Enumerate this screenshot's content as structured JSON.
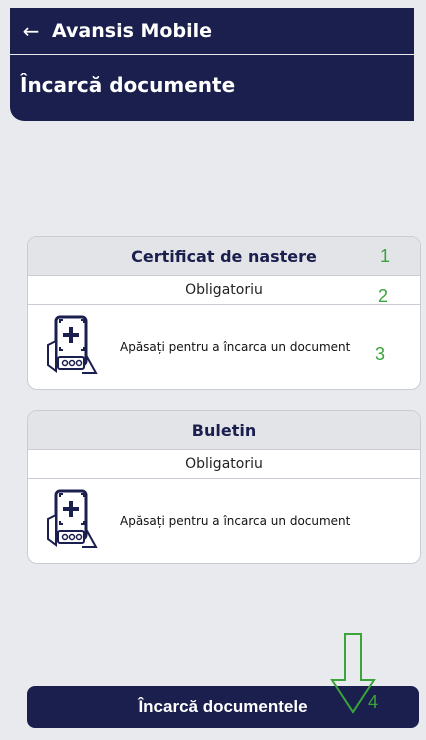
{
  "header": {
    "back_icon": "arrow-left-icon",
    "app_title": "Avansis Mobile"
  },
  "subheader": {
    "title": "Încarcă documente"
  },
  "documents": [
    {
      "title": "Certificat de nastere",
      "requirement": "Obligatoriu",
      "upload_prompt": "Apăsați pentru a încarca un document",
      "icon": "phone-add-document-icon"
    },
    {
      "title": "Buletin",
      "requirement": "Obligatoriu",
      "upload_prompt": "Apăsați pentru a încarca un document",
      "icon": "phone-add-document-icon"
    }
  ],
  "annotations": {
    "m1": "1",
    "m2": "2",
    "m3": "3",
    "m4": "4",
    "color": "#3aa43a"
  },
  "submit": {
    "label": "Încarcă documentele"
  },
  "colors": {
    "primary": "#1b1f4e",
    "background": "#e9eaee",
    "card_header": "#e3e4e8"
  }
}
